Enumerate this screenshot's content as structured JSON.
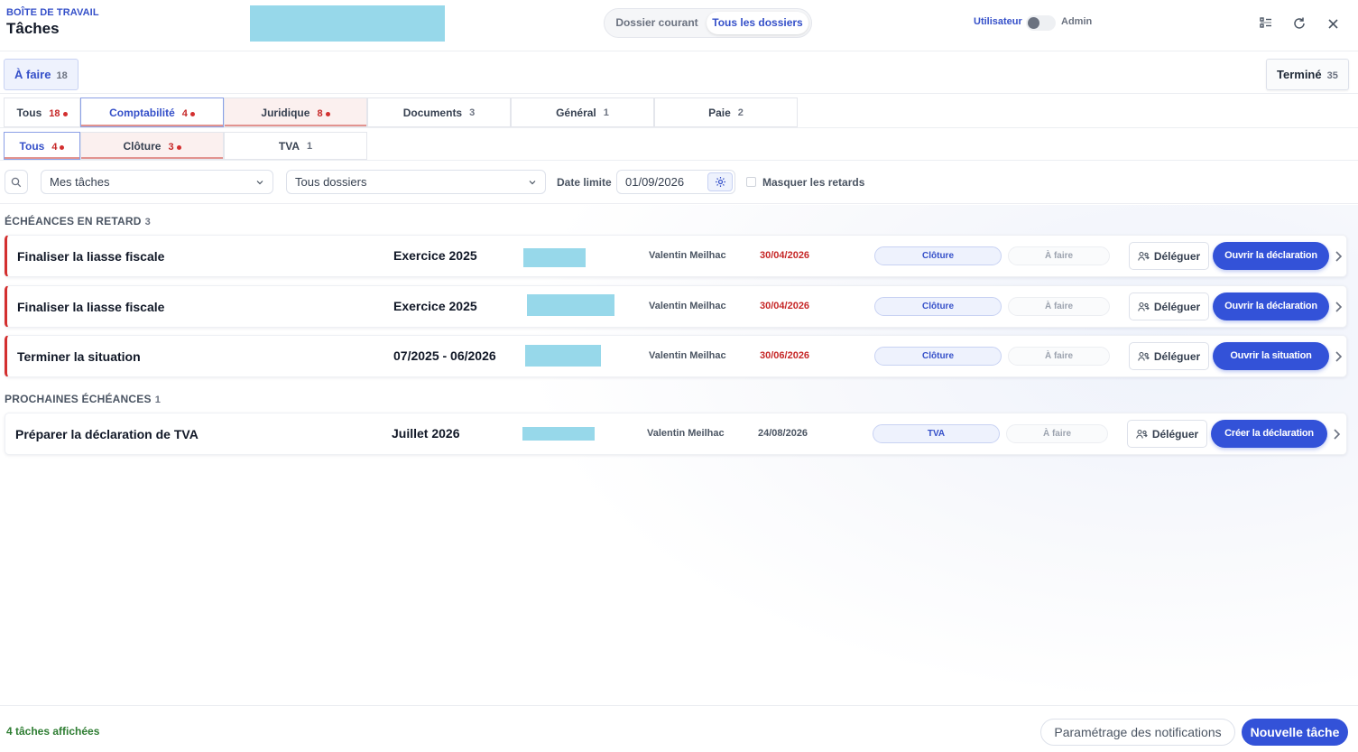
{
  "header": {
    "subtitle": "BOÎTE DE TRAVAIL",
    "title": "Tâches",
    "scope_tabs": [
      {
        "label": "Dossier courant",
        "active": false
      },
      {
        "label": "Tous les dossiers",
        "active": true
      }
    ],
    "role_left": "Utilisateur",
    "role_right": "Admin",
    "icons": [
      "list-settings-icon",
      "refresh-icon",
      "close-icon"
    ]
  },
  "status_tabs": {
    "todo": {
      "label": "À faire",
      "count": "18"
    },
    "done": {
      "label": "Terminé",
      "count": "35"
    }
  },
  "category_tabs": [
    {
      "label": "Tous",
      "count": "18",
      "alert": true
    },
    {
      "label": "Comptabilité",
      "count": "4",
      "alert": true
    },
    {
      "label": "Juridique",
      "count": "8",
      "alert": true
    },
    {
      "label": "Documents",
      "count": "3",
      "alert": false
    },
    {
      "label": "Général",
      "count": "1",
      "alert": false
    },
    {
      "label": "Paie",
      "count": "2",
      "alert": false
    }
  ],
  "subcategory_tabs": [
    {
      "label": "Tous",
      "count": "4",
      "alert": true
    },
    {
      "label": "Clôture",
      "count": "3",
      "alert": true
    },
    {
      "label": "TVA",
      "count": "1",
      "alert": false
    }
  ],
  "filters": {
    "assignee": "Mes tâches",
    "folders": "Tous dossiers",
    "deadline_label": "Date limite",
    "deadline_value": "01/09/2026",
    "hide_late_label": "Masquer les retards"
  },
  "sections": {
    "late": {
      "title": "ÉCHÉANCES EN RETARD",
      "count": "3"
    },
    "upcoming": {
      "title": "PROCHAINES ÉCHÉANCES",
      "count": "1"
    }
  },
  "late_tasks": [
    {
      "title": "Finaliser la liasse fiscale",
      "period": "Exercice 2025",
      "user": "Valentin Meilhac",
      "due": "30/04/2026",
      "category": "Clôture",
      "status": "À faire",
      "delegate": "Déléguer",
      "action": "Ouvrir la déclaration"
    },
    {
      "title": "Finaliser la liasse fiscale",
      "period": "Exercice 2025",
      "user": "Valentin Meilhac",
      "due": "30/04/2026",
      "category": "Clôture",
      "status": "À faire",
      "delegate": "Déléguer",
      "action": "Ouvrir la déclaration"
    },
    {
      "title": "Terminer la situation",
      "period": "07/2025 - 06/2026",
      "user": "Valentin Meilhac",
      "due": "30/06/2026",
      "category": "Clôture",
      "status": "À faire",
      "delegate": "Déléguer",
      "action": "Ouvrir la situation"
    }
  ],
  "upcoming_tasks": [
    {
      "title": "Préparer la déclaration de TVA",
      "period": "Juillet 2026",
      "user": "Valentin Meilhac",
      "due": "24/08/2026",
      "category": "TVA",
      "status": "À faire",
      "delegate": "Déléguer",
      "action": "Créer la déclaration"
    }
  ],
  "footer": {
    "count_text": "4 tâches affichées",
    "notif_button": "Paramétrage des notifications",
    "new_button": "Nouvelle tâche"
  },
  "colors": {
    "accent": "#3352d8",
    "late": "#c62828",
    "success": "#2e7d32"
  }
}
